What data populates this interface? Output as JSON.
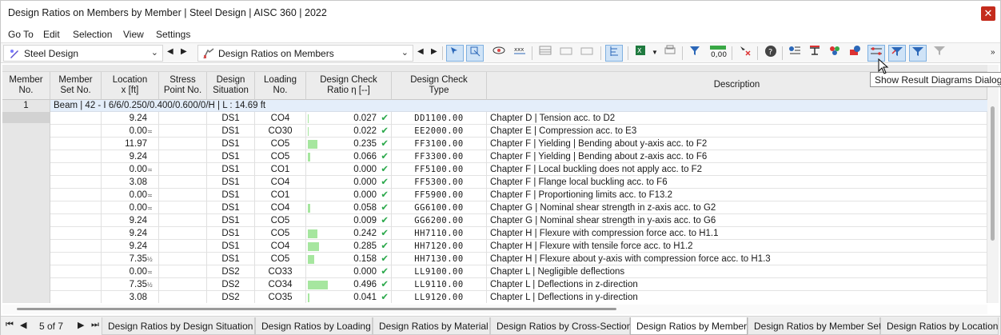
{
  "window": {
    "title": "Design Ratios on Members by Member | Steel Design | AISC 360 | 2022",
    "close_icon": "close-icon"
  },
  "menu": [
    "Go To",
    "Edit",
    "Selection",
    "View",
    "Settings"
  ],
  "toolbar": {
    "module_combo": "Steel Design",
    "result_combo": "Design Ratios on Members",
    "tooltip": "Show Result Diagrams Dialog"
  },
  "table": {
    "headers": [
      [
        "Member",
        "No."
      ],
      [
        "Member",
        "Set No."
      ],
      [
        "Location",
        "x [ft]"
      ],
      [
        "Stress",
        "Point No."
      ],
      [
        "Design",
        "Situation"
      ],
      [
        "Loading",
        "No."
      ],
      [
        "Design Check",
        "Ratio η [--]"
      ],
      [
        "Design Check",
        "Type"
      ],
      [
        "Description",
        ""
      ]
    ],
    "member_no": "1",
    "group_label": "Beam | 42 - I 6/6/0.250/0.400/0.600/0/H | L : 14.69 ft",
    "rows": [
      {
        "x": "9.24",
        "mark": "",
        "ds": "DS1",
        "load": "CO4",
        "ratio": "0.027",
        "ratio_num": 0.027,
        "type": "DD1100.00",
        "desc": "Chapter D | Tension acc. to D2"
      },
      {
        "x": "0.00",
        "mark": "≍",
        "ds": "DS1",
        "load": "CO30",
        "ratio": "0.022",
        "ratio_num": 0.022,
        "type": "EE2000.00",
        "desc": "Chapter E | Compression acc. to E3"
      },
      {
        "x": "11.97",
        "mark": "",
        "ds": "DS1",
        "load": "CO5",
        "ratio": "0.235",
        "ratio_num": 0.235,
        "type": "FF3100.00",
        "desc": "Chapter F | Yielding | Bending about y-axis acc. to F2"
      },
      {
        "x": "9.24",
        "mark": "",
        "ds": "DS1",
        "load": "CO5",
        "ratio": "0.066",
        "ratio_num": 0.066,
        "type": "FF3300.00",
        "desc": "Chapter F | Yielding | Bending about z-axis acc. to F6"
      },
      {
        "x": "0.00",
        "mark": "≍",
        "ds": "DS1",
        "load": "CO1",
        "ratio": "0.000",
        "ratio_num": 0.0,
        "type": "FF5100.00",
        "desc": "Chapter F | Local buckling does not apply acc. to F2"
      },
      {
        "x": "3.08",
        "mark": "",
        "ds": "DS1",
        "load": "CO4",
        "ratio": "0.000",
        "ratio_num": 0.0,
        "type": "FF5300.00",
        "desc": "Chapter F | Flange local buckling acc. to F6"
      },
      {
        "x": "0.00",
        "mark": "≍",
        "ds": "DS1",
        "load": "CO1",
        "ratio": "0.000",
        "ratio_num": 0.0,
        "type": "FF5900.00",
        "desc": "Chapter F | Proportioning limits acc. to F13.2"
      },
      {
        "x": "0.00",
        "mark": "≍",
        "ds": "DS1",
        "load": "CO4",
        "ratio": "0.058",
        "ratio_num": 0.058,
        "type": "GG6100.00",
        "desc": "Chapter G | Nominal shear strength in z-axis acc. to G2"
      },
      {
        "x": "9.24",
        "mark": "",
        "ds": "DS1",
        "load": "CO5",
        "ratio": "0.009",
        "ratio_num": 0.009,
        "type": "GG6200.00",
        "desc": "Chapter G | Nominal shear strength in y-axis acc. to G6"
      },
      {
        "x": "9.24",
        "mark": "",
        "ds": "DS1",
        "load": "CO5",
        "ratio": "0.242",
        "ratio_num": 0.242,
        "type": "HH7110.00",
        "desc": "Chapter H | Flexure with compression force acc. to H1.1"
      },
      {
        "x": "9.24",
        "mark": "",
        "ds": "DS1",
        "load": "CO4",
        "ratio": "0.285",
        "ratio_num": 0.285,
        "type": "HH7120.00",
        "desc": "Chapter H | Flexure with tensile force acc. to H1.2"
      },
      {
        "x": "7.35",
        "mark": "½",
        "ds": "DS1",
        "load": "CO5",
        "ratio": "0.158",
        "ratio_num": 0.158,
        "type": "HH7130.00",
        "desc": "Chapter H | Flexure about y-axis with compression force acc. to H1.3"
      },
      {
        "x": "0.00",
        "mark": "≍",
        "ds": "DS2",
        "load": "CO33",
        "ratio": "0.000",
        "ratio_num": 0.0,
        "type": "LL9100.00",
        "desc": "Chapter L | Negligible deflections"
      },
      {
        "x": "7.35",
        "mark": "½",
        "ds": "DS2",
        "load": "CO34",
        "ratio": "0.496",
        "ratio_num": 0.496,
        "type": "LL9110.00",
        "desc": "Chapter L | Deflections in z-direction"
      },
      {
        "x": "3.08",
        "mark": "",
        "ds": "DS2",
        "load": "CO35",
        "ratio": "0.041",
        "ratio_num": 0.041,
        "type": "LL9120.00",
        "desc": "Chapter L | Deflections in y-direction"
      }
    ]
  },
  "pager": {
    "label": "5 of 7"
  },
  "tabs": [
    "Design Ratios by Design Situation",
    "Design Ratios by Loading",
    "Design Ratios by Material",
    "Design Ratios by Cross-Section",
    "Design Ratios by Member",
    "Design Ratios by Member Set",
    "Design Ratios by Location"
  ],
  "active_tab": 4,
  "colors": {
    "ratio_bar": "#a6e69f",
    "check": "#2aa84a",
    "group_row": "#e4eefa",
    "active_toggle": "#cfe3f7"
  }
}
